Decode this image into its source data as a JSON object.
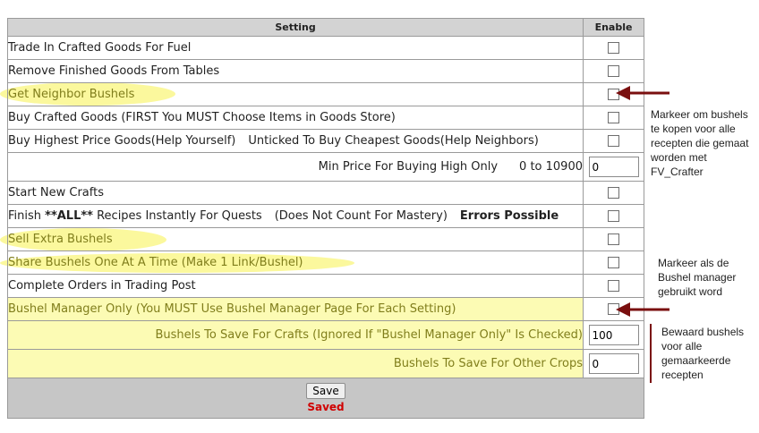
{
  "header": {
    "setting": "Setting",
    "enable": "Enable"
  },
  "rows": {
    "trade_in": {
      "label": "Trade In Crafted Goods For Fuel",
      "checked": false
    },
    "remove_finished": {
      "label": "Remove Finished Goods From Tables",
      "checked": false
    },
    "get_neighbor_bushels": {
      "label": "Get Neighbor Bushels",
      "checked": false
    },
    "buy_crafted": {
      "label": "Buy Crafted Goods (FIRST You MUST Choose Items in Goods Store)",
      "checked": false
    },
    "buy_highest": {
      "label": "Buy Highest Price Goods(Help Yourself)",
      "label_b": "Unticked To Buy Cheapest Goods(Help Neighbors)",
      "checked": false
    },
    "min_price": {
      "label": "Min Price For Buying High Only",
      "range": "0 to 10900",
      "value": "0"
    },
    "start_new": {
      "label": "Start New Crafts",
      "checked": false
    },
    "finish_all": {
      "label_pre": "Finish ",
      "label_bold": "**ALL**",
      "label_mid": " Recipes Instantly For Quests",
      "label_note": "(Does Not Count For Mastery)",
      "label_warn": "Errors Possible",
      "checked": false
    },
    "sell_extra": {
      "label": "Sell Extra Bushels",
      "checked": false
    },
    "share_bushels": {
      "label": "Share Bushels One At A Time (Make 1 Link/Bushel)",
      "checked": false
    },
    "complete_orders": {
      "label": "Complete Orders in Trading Post",
      "checked": false
    },
    "bushel_manager_only": {
      "label": "Bushel Manager Only (You MUST Use Bushel Manager Page For Each Setting)",
      "checked": false
    },
    "bushels_crafts": {
      "label": "Bushels To Save For Crafts (Ignored If \"Bushel Manager Only\" Is Checked)",
      "value": "100"
    },
    "bushels_other": {
      "label": "Bushels To Save For Other Crops",
      "value": "0"
    }
  },
  "footer": {
    "save_label": "Save",
    "status": "Saved"
  },
  "annotations": {
    "note1": [
      "Markeer om bushels",
      "te kopen voor alle",
      "recepten die gemaat",
      "worden met",
      "FV_Crafter"
    ],
    "note2": [
      "Markeer als de",
      "Bushel manager",
      "gebruikt word"
    ],
    "note3": [
      "Bewaard bushels",
      "voor alle",
      "gemaarkeerde",
      "recepten"
    ]
  },
  "colors": {
    "highlight": "#fbf89d",
    "highlight_text": "#807e1c",
    "arrow": "#7a0f0f",
    "status": "#d00000"
  }
}
